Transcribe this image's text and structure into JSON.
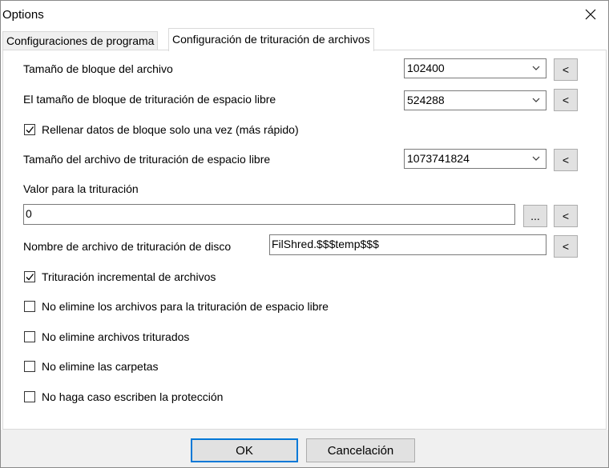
{
  "window": {
    "title": "Options"
  },
  "tabs": [
    {
      "label": "Configuraciones de programa",
      "active": false
    },
    {
      "label": "Configuración de trituración de archivos",
      "active": true
    }
  ],
  "settings": {
    "block_size": {
      "label": "Tamaño de bloque del archivo",
      "value": "102400",
      "reset": "<"
    },
    "free_space_block_size": {
      "label": "El tamaño de bloque de trituración de espacio libre",
      "value": "524288",
      "reset": "<"
    },
    "fill_once": {
      "label": "Rellenar datos de bloque solo una vez (más rápido)",
      "checked": true
    },
    "free_space_file_size": {
      "label": "Tamaño del archivo de trituración de espacio libre",
      "value": "1073741824",
      "reset": "<"
    },
    "shred_value": {
      "label": "Valor para la trituración",
      "value": "0",
      "browse": "...",
      "reset": "<"
    },
    "disk_filename": {
      "label": "Nombre de archivo de trituración de disco",
      "value": "FilShred.$$$temp$$$",
      "reset": "<"
    },
    "incremental": {
      "label": "Trituración incremental de archivos",
      "checked": true
    },
    "keep_free_space_files": {
      "label": "No elimine los archivos para la trituración de espacio libre",
      "checked": false
    },
    "keep_shredded_files": {
      "label": "No elimine archivos triturados",
      "checked": false
    },
    "keep_folders": {
      "label": "No elimine las carpetas",
      "checked": false
    },
    "ignore_write_protection": {
      "label": "No haga caso escriben la protección",
      "checked": false
    }
  },
  "footer": {
    "ok_label": "OK",
    "cancel_label": "Cancelación"
  },
  "colors": {
    "accent": "#0078d7",
    "button_bg": "#e1e1e1",
    "footer_bg": "#f0f0f0"
  }
}
